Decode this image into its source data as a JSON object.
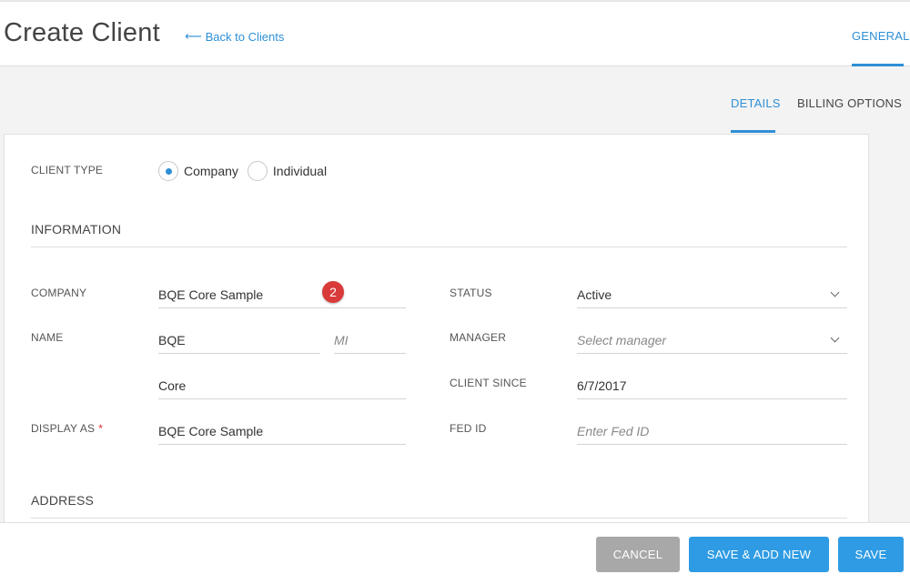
{
  "header": {
    "title": "Create Client",
    "back_link": "Back to Clients",
    "tab": "GENERAL"
  },
  "subtabs": {
    "details": "DETAILS",
    "billing": "BILLING OPTIONS"
  },
  "client_type": {
    "label": "CLIENT TYPE",
    "options": [
      "Company",
      "Individual"
    ],
    "selected": "Company"
  },
  "information": {
    "title": "INFORMATION",
    "company_label": "COMPANY",
    "company_value": "BQE Core Sample",
    "name_label": "NAME",
    "first_name": "BQE",
    "mi_placeholder": "MI",
    "last_name": "Core",
    "display_as_label": "DISPLAY AS",
    "required_mark": "*",
    "display_as_value": "BQE Core Sample",
    "status_label": "STATUS",
    "status_value": "Active",
    "manager_label": "MANAGER",
    "manager_placeholder": "Select manager",
    "client_since_label": "CLIENT SINCE",
    "client_since_value": "6/7/2017",
    "fed_id_label": "FED ID",
    "fed_id_placeholder": "Enter Fed ID"
  },
  "badge": "2",
  "address": {
    "title": "ADDRESS"
  },
  "footer": {
    "cancel": "CANCEL",
    "save_add": "SAVE & ADD NEW",
    "save": "SAVE"
  },
  "colors": {
    "accent": "#2e8fd6",
    "button": "#2e9be4",
    "cancel": "#a8a8a8",
    "badge": "#d93a3a"
  }
}
